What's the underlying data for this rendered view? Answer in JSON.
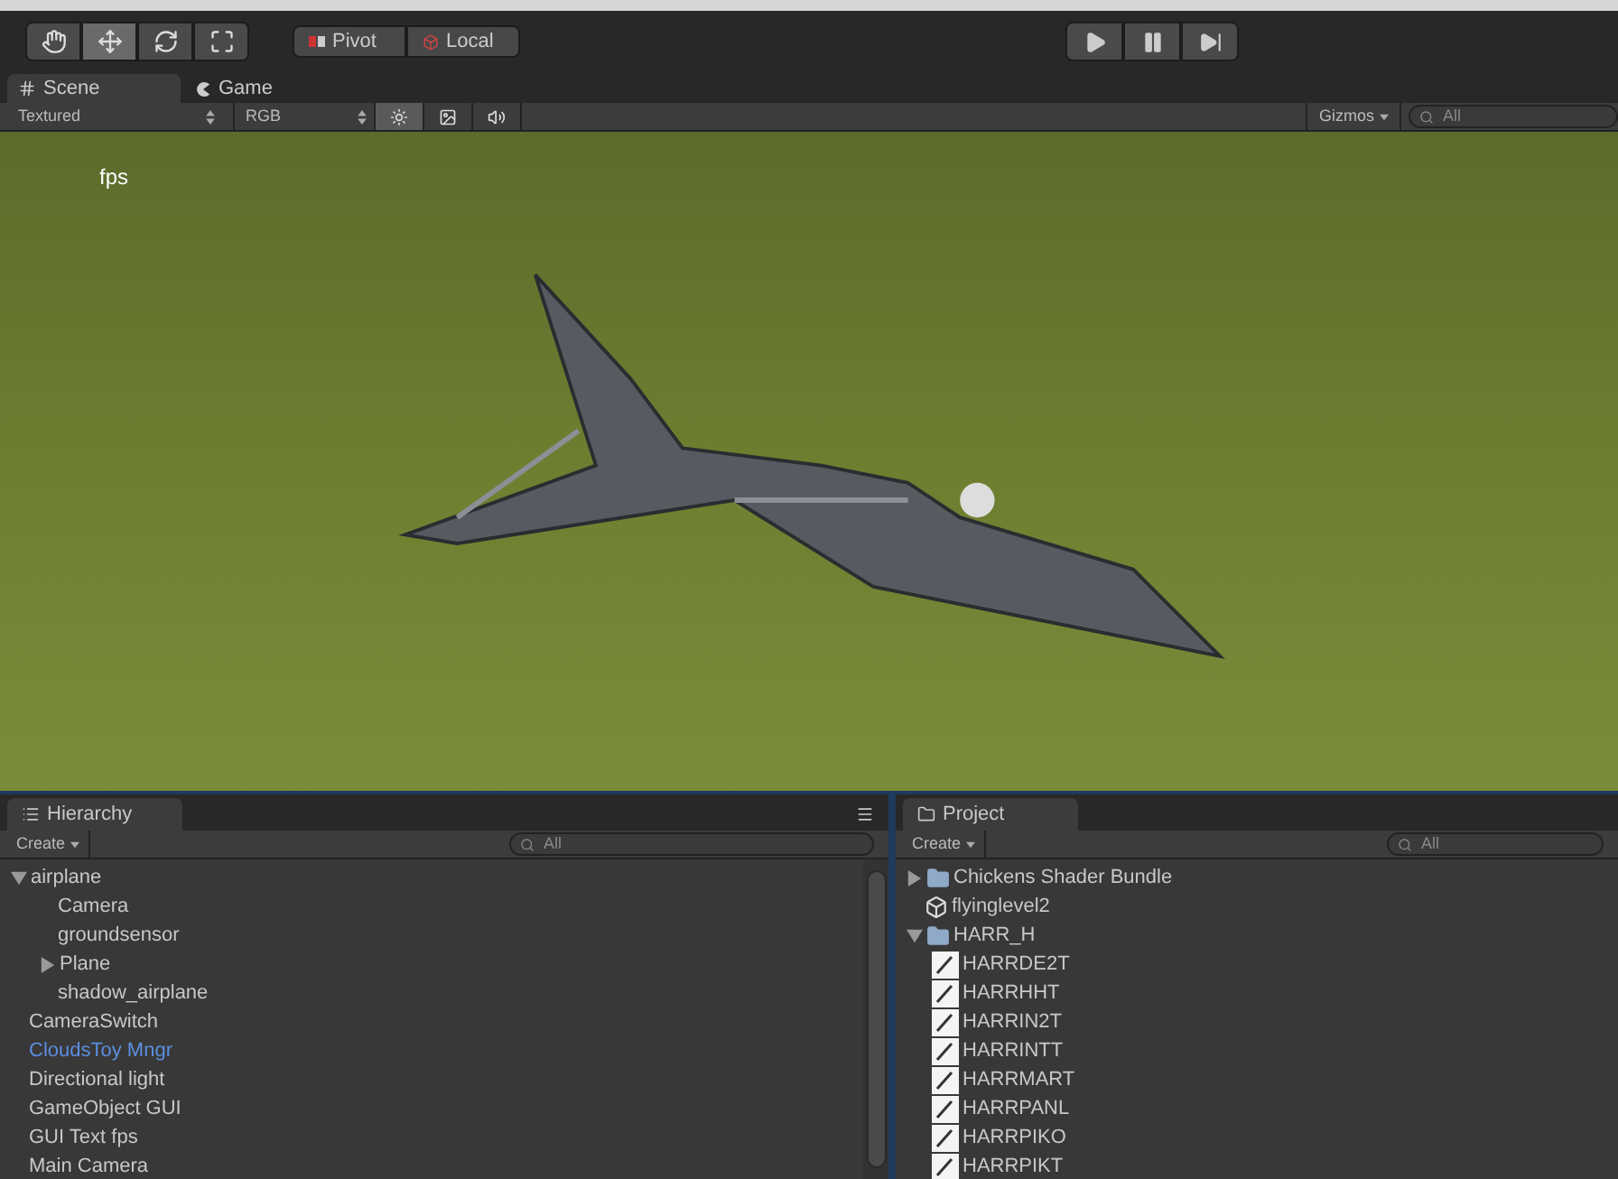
{
  "toolbar": {
    "tools": [
      {
        "kind": "hand",
        "selected": false
      },
      {
        "kind": "move",
        "selected": true
      },
      {
        "kind": "rotate",
        "selected": false
      },
      {
        "kind": "scale",
        "selected": false
      }
    ],
    "pivot": [
      {
        "label": "Pivot",
        "kind": "pivot"
      },
      {
        "label": "Local",
        "kind": "local"
      }
    ],
    "playback": [
      {
        "kind": "play"
      },
      {
        "kind": "pause"
      },
      {
        "kind": "step"
      }
    ]
  },
  "view_tabs": [
    {
      "label": "Scene",
      "kind": "scene",
      "selected": true
    },
    {
      "label": "Game",
      "kind": "game",
      "selected": false
    }
  ],
  "scene_bar": {
    "render_mode": "Textured",
    "channel": "RGB",
    "toggles": [
      {
        "kind": "lighting",
        "on": true
      },
      {
        "kind": "image",
        "on": false
      },
      {
        "kind": "audio",
        "on": false
      }
    ],
    "gizmos": "Gizmos",
    "search": {
      "placeholder": "All"
    }
  },
  "viewport": {
    "overlay_text": "fps"
  },
  "hierarchy": {
    "title": "Hierarchy",
    "create": "Create",
    "search": {
      "placeholder": "All"
    },
    "items": [
      {
        "label": "airplane",
        "prefab": false,
        "expanded": true,
        "children": [
          {
            "label": "Camera",
            "prefab": false
          },
          {
            "label": "groundsensor",
            "prefab": false
          },
          {
            "label": "Plane",
            "prefab": false,
            "expanded": false
          },
          {
            "label": "shadow_airplane",
            "prefab": false
          }
        ]
      },
      {
        "label": "CameraSwitch",
        "prefab": false
      },
      {
        "label": "CloudsToy Mngr",
        "prefab": true
      },
      {
        "label": "Directional light",
        "prefab": false
      },
      {
        "label": "GameObject GUI",
        "prefab": false
      },
      {
        "label": "GUI Text fps",
        "prefab": false
      },
      {
        "label": "Main Camera",
        "prefab": false
      }
    ]
  },
  "project": {
    "title": "Project",
    "create": "Create",
    "search": {
      "placeholder": "All"
    },
    "items": [
      {
        "label": "Chickens Shader Bundle",
        "kind": "folder",
        "expanded": false
      },
      {
        "label": "flyinglevel2",
        "kind": "scene"
      },
      {
        "label": "HARR_H",
        "kind": "folder",
        "expanded": true,
        "children": [
          {
            "label": "HARRDE2T",
            "kind": "texture"
          },
          {
            "label": "HARRHHT",
            "kind": "texture"
          },
          {
            "label": "HARRIN2T",
            "kind": "texture"
          },
          {
            "label": "HARRINTT",
            "kind": "texture"
          },
          {
            "label": "HARRMART",
            "kind": "texture"
          },
          {
            "label": "HARRPANL",
            "kind": "texture"
          },
          {
            "label": "HARRPIKO",
            "kind": "texture"
          },
          {
            "label": "HARRPIKT",
            "kind": "texture"
          }
        ]
      }
    ]
  }
}
